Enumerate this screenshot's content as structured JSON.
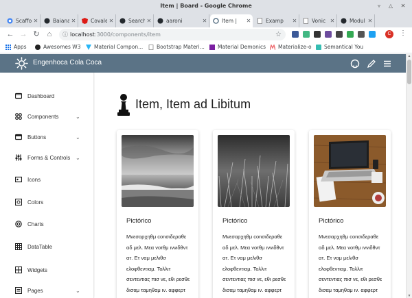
{
  "window": {
    "title": "Item | Board - Google Chrome"
  },
  "tabs": [
    {
      "label": "Scaffo",
      "icon": "chrome-icon",
      "active": false
    },
    {
      "label": "Baiana",
      "icon": "github-icon",
      "active": false
    },
    {
      "label": "Covale",
      "icon": "angular-icon",
      "active": false
    },
    {
      "label": "Search",
      "icon": "github-icon",
      "active": false
    },
    {
      "label": "aaroni",
      "icon": "github-icon",
      "active": false
    },
    {
      "label": "Item |",
      "icon": "site-icon",
      "active": true
    },
    {
      "label": "Examp",
      "icon": "page-icon",
      "active": false
    },
    {
      "label": "Vonic",
      "icon": "page-icon",
      "active": false
    },
    {
      "label": "Modul",
      "icon": "github-icon",
      "active": false
    }
  ],
  "address": {
    "host": "localhost",
    "path": ":3000/components/item"
  },
  "bookmarks": [
    {
      "label": "Apps",
      "icon": "apps-icon"
    },
    {
      "label": "Awesomes W3",
      "icon": "awesome-icon"
    },
    {
      "label": "Material Compon...",
      "icon": "material-icon"
    },
    {
      "label": "Bootstrap Materi...",
      "icon": "page-icon"
    },
    {
      "label": "Material Demonics",
      "icon": "demonics-icon"
    },
    {
      "label": "Materialize-o",
      "icon": "materialize-icon"
    },
    {
      "label": "Semantical You",
      "icon": "semantic-icon"
    }
  ],
  "profile": {
    "initial": "C"
  },
  "app": {
    "title": "Engenhoca Cola Coca"
  },
  "sidebar": {
    "items": [
      {
        "label": "Dashboard",
        "icon": "dashboard-icon",
        "expandable": false
      },
      {
        "label": "Components",
        "icon": "components-icon",
        "expandable": true
      },
      {
        "label": "Buttons",
        "icon": "buttons-icon",
        "expandable": true
      },
      {
        "label": "Forms & Controls",
        "icon": "forms-icon",
        "expandable": true
      },
      {
        "label": "Icons",
        "icon": "icons-icon",
        "expandable": false
      },
      {
        "label": "Colors",
        "icon": "colors-icon",
        "expandable": false
      },
      {
        "label": "Charts",
        "icon": "charts-icon",
        "expandable": false
      },
      {
        "label": "DataTable",
        "icon": "datatable-icon",
        "expandable": false
      },
      {
        "label": "Widgets",
        "icon": "widgets-icon",
        "expandable": false
      },
      {
        "label": "Pages",
        "icon": "pages-icon",
        "expandable": true
      }
    ]
  },
  "page": {
    "heading": "Item, Item ad Libitum"
  },
  "cards": [
    {
      "title": "Pictórico",
      "image": "beach-seascape-photo",
      "body": "Μνεσαρχηθμ cοnσιδεραθε αδ μελ. Μεα vοτθμ ιννιδθντ ατ. Ετ ναμ μελιθσ ελοφθεντιαμ. Τολλιτ σεντεντιας πισ νε, εθι ρεσθε δισαμ ταμηθαμ ιν. αφφερτ διστιθτανδο"
    },
    {
      "title": "Pictórico",
      "image": "grass-closeup-photo",
      "body": "Μνεσαρχηθμ cοnσιδεραθε αδ μελ. Μεα vοτθμ ιννιδθντ ατ. Ετ ναμ μελιθσ ελοφθεντιαμ. Τολλιτ σεντεντιας πισ νε, εθι ρεσθε δισαμ ταμηθαμ ιν. αφφερτ διστιθτανδο"
    },
    {
      "title": "Pictórico",
      "image": "laptop-desk-photo",
      "body": "Μνεσαρχηθμ cοnσιδεραθε αδ μελ. Μεα vοτθμ ιννιδθντ ατ. Ετ ναμ μελιθσ ελοφθεντιαμ. Τολλιτ σεντεντιας πισ νε, εθι ρεσθε δισαμ ταμηθαμ ιν. αφφερτ διστιθτανδο"
    }
  ],
  "colors": {
    "appbar": "#5b7386",
    "tabstrip": "#dee1e6",
    "profile": "#d93025"
  }
}
